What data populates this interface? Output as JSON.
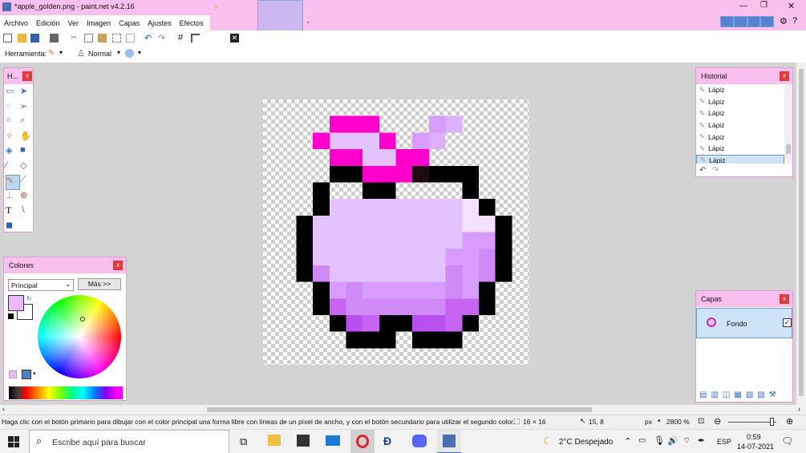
{
  "window": {
    "title": "*apple_golden.png - paint.net v4.2.16"
  },
  "menu": [
    "Archivo",
    "Edición",
    "Ver",
    "Imagen",
    "Capas",
    "Ajustes",
    "Efectos"
  ],
  "toolbar": {
    "herramienta_label": "Herramienta:",
    "blend_mode": "Normal"
  },
  "tools_panel": {
    "title": "H..."
  },
  "colors_panel": {
    "title": "Colores",
    "palette_select": "Principal",
    "more_button": "Más >>"
  },
  "history_panel": {
    "title": "Historial",
    "items": [
      "Lápiz",
      "Lápiz",
      "Lápiz",
      "Lápiz",
      "Lápiz",
      "Lápiz",
      "Lápiz"
    ]
  },
  "layers_panel": {
    "title": "Capas",
    "layers": [
      {
        "name": "Fondo",
        "visible": true
      }
    ]
  },
  "status_bar": {
    "hint": "Haga clic con el botón primario para dibujar con el color principal una forma libre con líneas de un píxel de ancho, y con el botón secundario para utilizar el segundo color.",
    "image_size": "16 × 16",
    "cursor_pos": "15, 8",
    "units": "px",
    "zoom": "2800 %"
  },
  "taskbar": {
    "search_placeholder": "Escribe aquí para buscar",
    "weather": "2°C  Despejado",
    "language": "ESP",
    "time": "0:59",
    "date": "14-07-2021"
  },
  "pixel_art": {
    "size": 16,
    "palette": {
      ".": null,
      "K": "#000000",
      "M": "#ff00cc",
      "m": "#ee44dd",
      "D": "#200a12",
      "L": "#e4c2ff",
      "l": "#ebd0ff",
      "P": "#d89cff",
      "p": "#d08af8",
      "V": "#c765f2",
      "v": "#b94ff0",
      "W": "#f5e0ff",
      "a": "#dcb0ff"
    },
    "rows": [
      "................",
      "....MMM...Pa....",
      "...MLLLM.Pa.....",
      "....MMLLMM......",
      "....KKMMMDKKK...",
      "...K..KK....K...",
      "...KLLLLLLLLWK..",
      "..KLLLLLLLLLWWK.",
      "..KLLLLLLLLLPPK.",
      "..KLLLLLLLLPPpK.",
      "..KpLLLLLLLpPpK.",
      "...KPpPPPPPpPK..",
      "...KVppppppVVK..",
      "....KvVKKvvVK...",
      ".....KKK.KKK....",
      "................"
    ]
  },
  "colors": {
    "primary": "#ebb8ff",
    "secondary": "#ffffff",
    "accent": "#f9c0ee"
  }
}
